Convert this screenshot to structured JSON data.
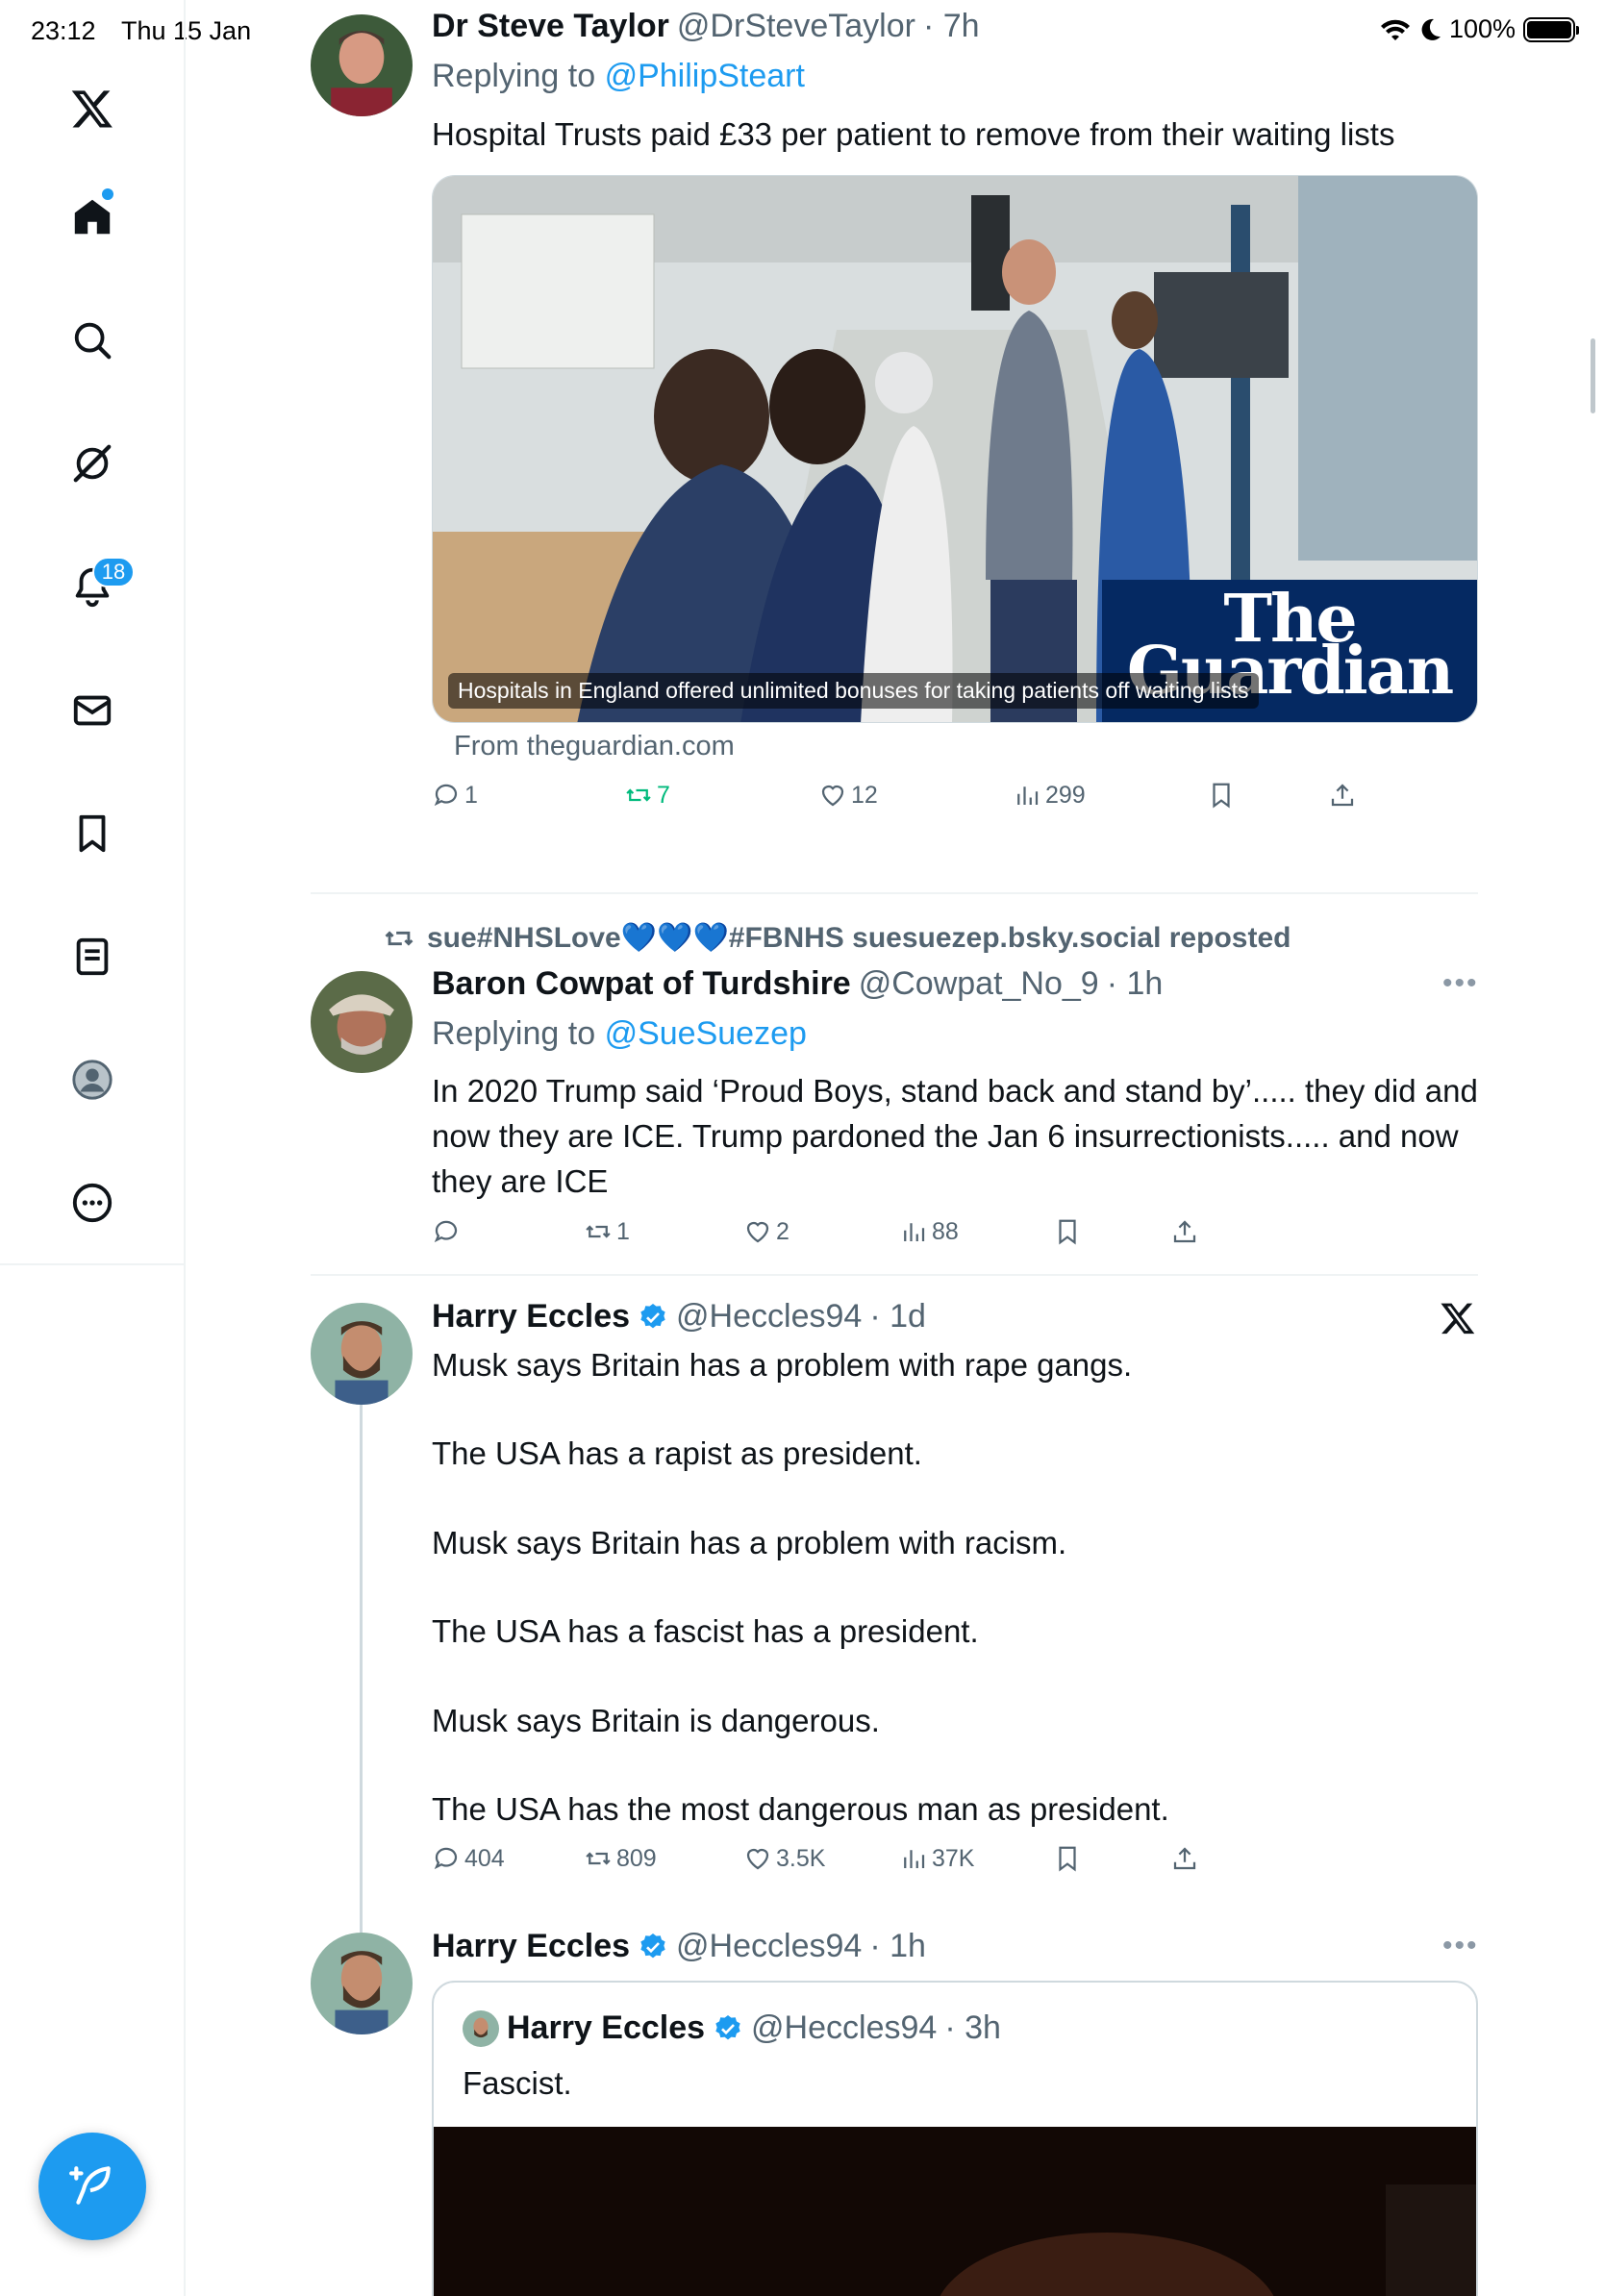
{
  "status_bar": {
    "time": "23:12",
    "date": "Thu 15 Jan",
    "battery": "100%"
  },
  "nav": {
    "items": [
      "x-logo",
      "home",
      "search",
      "grok",
      "notifications",
      "messages",
      "bookmarks",
      "lists",
      "profile",
      "more"
    ],
    "notification_count": "18",
    "accent_color": "#1d9bf0"
  },
  "tweets": [
    {
      "name": "Dr Steve Taylor",
      "handle": "@DrSteveTaylor",
      "time": "· 7h",
      "reply_prefix": "Replying to",
      "reply_to": "@PhilipSteart",
      "text": "Hospital Trusts paid £33 per patient to remove from their waiting lists",
      "card": {
        "caption": "Hospitals in England offered unlimited bonuses for taking patients off waiting lists",
        "logo": "The Guardian",
        "source": "From theguardian.com"
      },
      "stats": {
        "replies": "1",
        "reposts": "7",
        "likes": "12",
        "views": "299"
      }
    },
    {
      "repost_by": "sue#NHSLove💙💙💙#FBNHS suesuezep.bsky.social reposted",
      "name": "Baron Cowpat of Turdshire",
      "handle": "@Cowpat_No_9",
      "time": "· 1h",
      "reply_prefix": "Replying to",
      "reply_to": "@SueSuezep",
      "text": "In 2020 Trump said ‘Proud Boys, stand back and stand by’..... they did and now they are ICE. Trump pardoned the Jan 6 insurrectionists..... and now they are ICE",
      "stats": {
        "replies": "",
        "reposts": "1",
        "likes": "2",
        "views": "88"
      }
    },
    {
      "name": "Harry Eccles",
      "handle": "@Heccles94",
      "time": "· 1d",
      "text": "Musk says Britain has a problem with rape gangs.\n\nThe USA has a rapist as president.\n\nMusk says Britain has a problem with racism.\n\nThe USA has a fascist has a president.\n\nMusk says Britain is dangerous.\n\nThe USA has the most dangerous man as president.",
      "stats": {
        "replies": "404",
        "reposts": "809",
        "likes": "3.5K",
        "views": "37K"
      }
    },
    {
      "name": "Harry Eccles",
      "handle": "@Heccles94",
      "time": "· 1h",
      "quote": {
        "name": "Harry Eccles",
        "handle": "@Heccles94",
        "time": "· 3h",
        "text": "Fascist."
      }
    }
  ]
}
